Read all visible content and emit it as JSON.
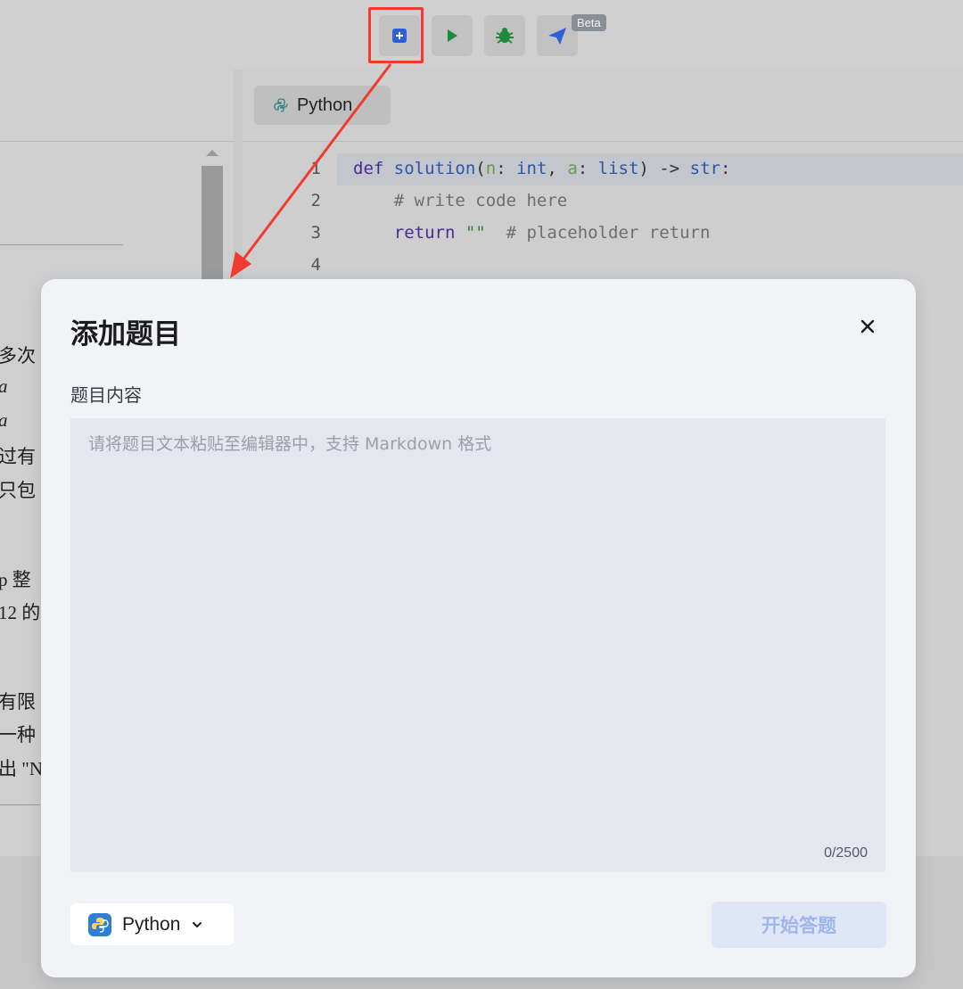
{
  "toolbar": {
    "buttons": [
      {
        "icon": "add-square-icon"
      },
      {
        "icon": "play-icon"
      },
      {
        "icon": "bug-icon"
      },
      {
        "icon": "send-icon"
      }
    ],
    "beta_badge": "Beta"
  },
  "editor": {
    "language_tab": "Python",
    "lines": [
      {
        "num": "1"
      },
      {
        "num": "2"
      },
      {
        "num": "3"
      },
      {
        "num": "4"
      }
    ]
  },
  "left_panel_fragments": [
    "多次",
    "a",
    "a",
    "过有",
    "只包",
    "p 整",
    "12 的",
    "有限",
    "一种",
    "出 \"N"
  ],
  "modal": {
    "title": "添加题目",
    "content_label": "题目内容",
    "textarea_placeholder": "请将题目文本粘贴至编辑器中，支持 Markdown 格式",
    "char_count": "0/2500",
    "language_select": "Python",
    "start_button": "开始答题"
  },
  "colors": {
    "highlight_box": "#f23b2f",
    "arrow": "#f23b2f",
    "primary_disabled": "#dfe7f7"
  }
}
